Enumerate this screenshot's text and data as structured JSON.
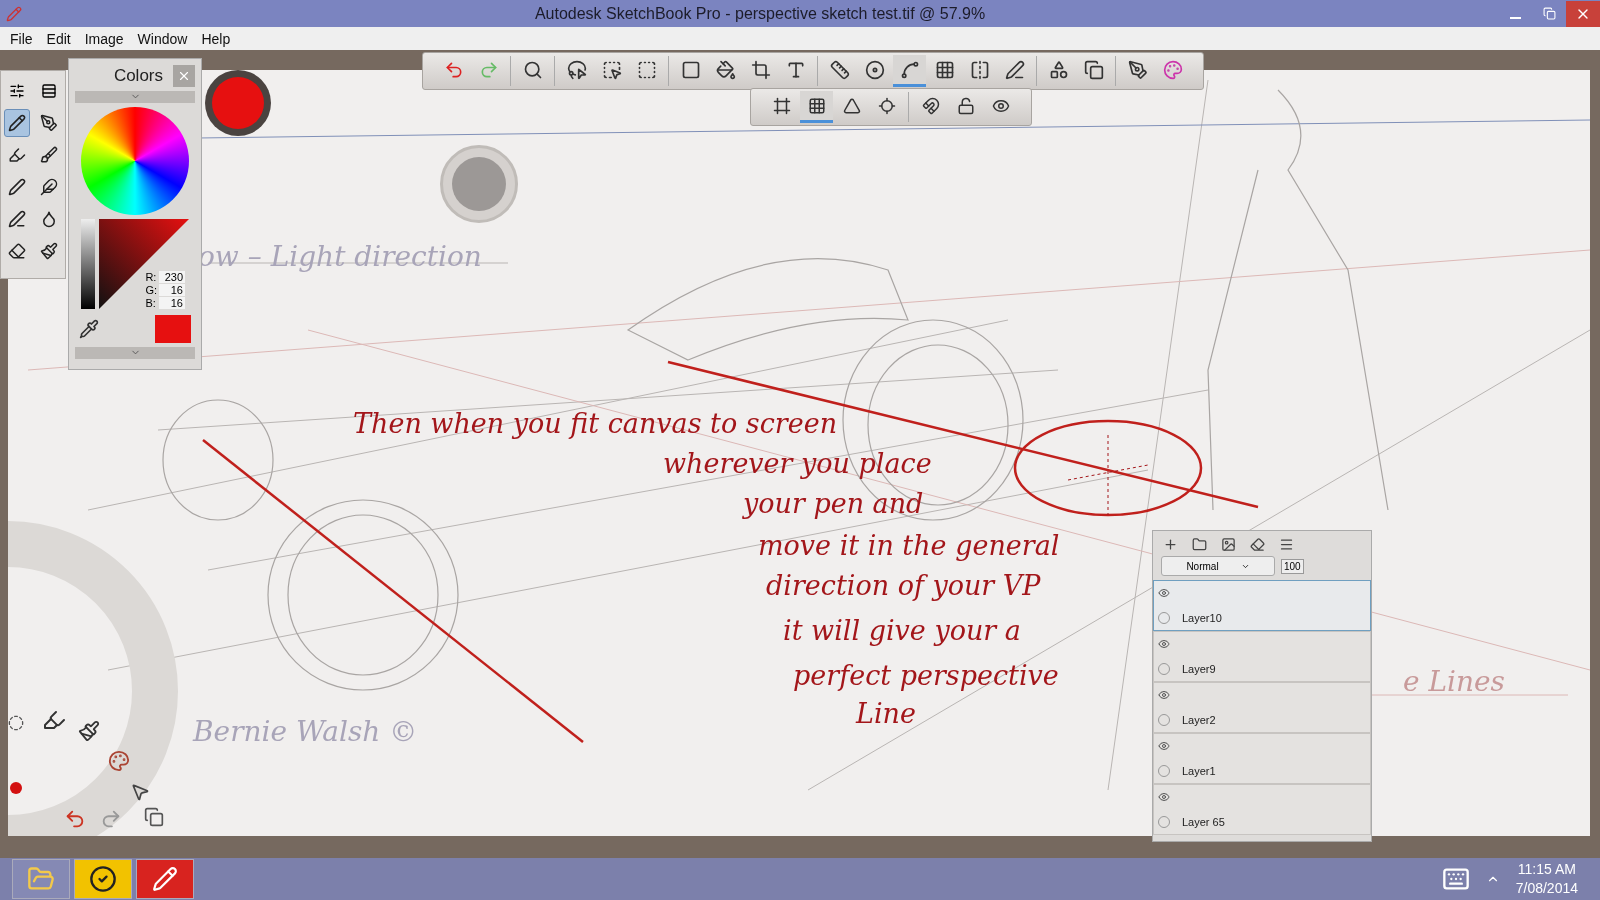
{
  "window": {
    "title": "Autodesk SketchBook Pro - perspective sketch test.tif @ 57.9%"
  },
  "menu": [
    "File",
    "Edit",
    "Image",
    "Window",
    "Help"
  ],
  "toolbar": {
    "tools": [
      {
        "selected": false
      },
      {
        "selected": false
      },
      {
        "selected": false
      },
      {
        "selected": false
      },
      {
        "selected": false
      },
      {
        "selected": false
      },
      {
        "selected": false
      },
      {
        "selected": false
      },
      {
        "selected": false
      },
      {
        "selected": false
      },
      {
        "selected": false
      },
      {
        "selected": false
      },
      {
        "selected": true
      },
      {
        "selected": false
      },
      {
        "selected": false
      },
      {
        "selected": false
      },
      {
        "selected": false
      },
      {
        "selected": false
      },
      {
        "selected": false
      },
      {
        "selected": false
      }
    ],
    "perspective_tools": [
      {
        "selected": false
      },
      {
        "selected": true
      },
      {
        "selected": false
      },
      {
        "selected": false
      },
      {
        "selected": false
      },
      {
        "selected": false
      },
      {
        "selected": false
      }
    ]
  },
  "brushes": [
    {
      "selected": true
    },
    {
      "selected": false
    },
    {
      "selected": false
    },
    {
      "selected": false
    },
    {
      "selected": false
    },
    {
      "selected": false
    },
    {
      "selected": false
    },
    {
      "selected": false
    },
    {
      "selected": false
    },
    {
      "selected": false
    }
  ],
  "colors": {
    "title": "Colors",
    "r_label": "R:",
    "r": "230",
    "g_label": "G:",
    "g": "16",
    "b_label": "B:",
    "b": "16",
    "color": "#e61010"
  },
  "canvas": {
    "notes": [
      {
        "kind": "grey",
        "text": "ow – Light direction"
      },
      {
        "kind": "red",
        "text": "Then when you fit canvas to screen"
      },
      {
        "kind": "red",
        "text": "wherever you place"
      },
      {
        "kind": "red",
        "text": "your pen and"
      },
      {
        "kind": "red",
        "text": "move it in the general"
      },
      {
        "kind": "red",
        "text": "direction of your VP"
      },
      {
        "kind": "red",
        "text": "it will give your a"
      },
      {
        "kind": "red",
        "text": "perfect perspective"
      },
      {
        "kind": "red",
        "text": "Line"
      },
      {
        "kind": "grey",
        "text": "Bernie Walsh ©"
      },
      {
        "kind": "pink",
        "text": "e Lines"
      }
    ]
  },
  "layers": {
    "blend_mode": "Normal",
    "opacity": "100",
    "items": [
      {
        "name": "Layer10",
        "selected": true,
        "visible": true
      },
      {
        "name": "Layer9",
        "selected": false,
        "visible": true
      },
      {
        "name": "Layer2",
        "selected": false,
        "visible": true
      },
      {
        "name": "Layer1",
        "selected": false,
        "visible": true
      },
      {
        "name": "Layer 65",
        "selected": false,
        "visible": true
      }
    ]
  },
  "taskbar": {
    "time": "11:15 AM",
    "date": "7/08/2014"
  }
}
